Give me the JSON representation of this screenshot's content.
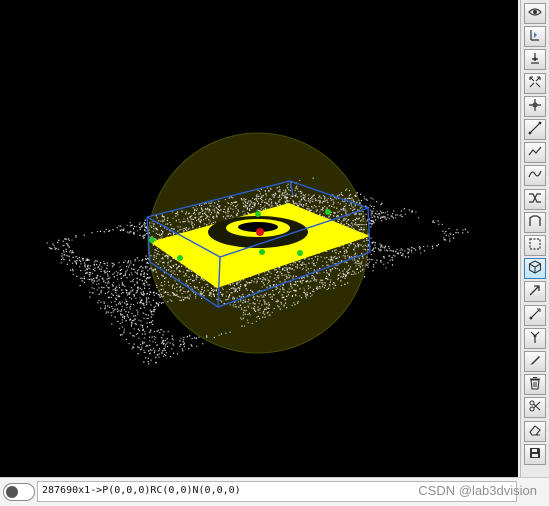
{
  "viewport": {
    "background": "#000000",
    "highlight_color": "#ffff00",
    "bbox_color": "#2a5fd0",
    "pivot_color": "#e01010",
    "handle_color": "#22cc22"
  },
  "toolbar": {
    "buttons": [
      {
        "id": "view",
        "icon": "eye-icon"
      },
      {
        "id": "select-point",
        "icon": "pick-point-icon"
      },
      {
        "id": "normal",
        "icon": "normal-icon"
      },
      {
        "id": "fit",
        "icon": "fit-icon"
      },
      {
        "id": "crosshair",
        "icon": "crosshair-icon"
      },
      {
        "id": "line",
        "icon": "line-icon"
      },
      {
        "id": "polyline",
        "icon": "polyline-icon"
      },
      {
        "id": "curve",
        "icon": "curve-icon"
      },
      {
        "id": "shuffle",
        "icon": "shuffle-icon"
      },
      {
        "id": "profile",
        "icon": "profile-icon"
      },
      {
        "id": "box-select",
        "icon": "box-select-icon"
      },
      {
        "id": "cube",
        "icon": "cube-icon",
        "active": true
      },
      {
        "id": "arrow",
        "icon": "arrow-icon"
      },
      {
        "id": "measure",
        "icon": "measure-icon"
      },
      {
        "id": "branch",
        "icon": "branch-icon"
      },
      {
        "id": "pen",
        "icon": "pen-icon"
      },
      {
        "id": "delete",
        "icon": "trash-icon"
      },
      {
        "id": "cut",
        "icon": "scissors-icon"
      },
      {
        "id": "erase",
        "icon": "eraser-icon"
      },
      {
        "id": "save",
        "icon": "save-icon"
      }
    ]
  },
  "status": {
    "text": "287690x1->P(0,0,0)RC(0,0)N(0,0,0)",
    "toggle_on": false
  },
  "watermark": "CSDN @lab3dvision"
}
